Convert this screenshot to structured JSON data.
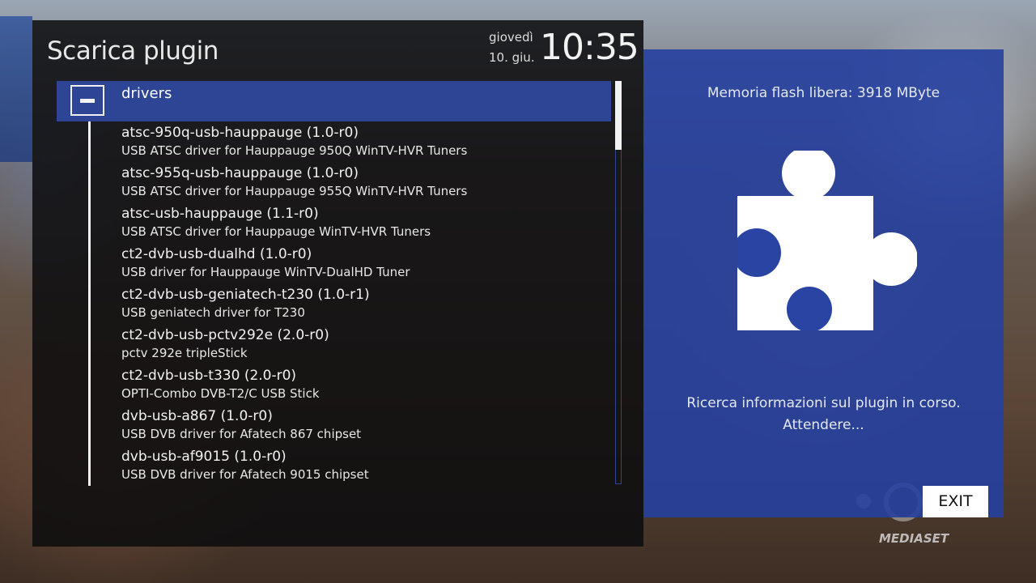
{
  "header": {
    "title": "Scarica plugin",
    "day": "giovedì",
    "date": "10. giu.",
    "time": "10:35"
  },
  "list": {
    "category": "drivers",
    "items": [
      {
        "name": "atsc-950q-usb-hauppauge  (1.0-r0)",
        "description": "USB ATSC driver for Hauppauge 950Q WinTV-HVR Tuners"
      },
      {
        "name": "atsc-955q-usb-hauppauge  (1.0-r0)",
        "description": "USB ATSC driver for Hauppauge 955Q WinTV-HVR Tuners"
      },
      {
        "name": "atsc-usb-hauppauge  (1.1-r0)",
        "description": "USB ATSC driver for Hauppauge WinTV-HVR Tuners"
      },
      {
        "name": "ct2-dvb-usb-dualhd  (1.0-r0)",
        "description": "USB driver for Hauppauge WinTV-DualHD Tuner"
      },
      {
        "name": "ct2-dvb-usb-geniatech-t230  (1.0-r1)",
        "description": "USB geniatech driver for T230"
      },
      {
        "name": "ct2-dvb-usb-pctv292e  (2.0-r0)",
        "description": "pctv 292e tripleStick"
      },
      {
        "name": "ct2-dvb-usb-t330  (2.0-r0)",
        "description": "OPTI-Combo DVB-T2/C USB Stick"
      },
      {
        "name": "dvb-usb-a867  (1.0-r0)",
        "description": "USB DVB driver for Afatech 867 chipset"
      },
      {
        "name": "dvb-usb-af9015  (1.0-r0)",
        "description": "USB DVB driver for Afatech 9015 chipset"
      }
    ]
  },
  "info": {
    "flash_memory": "Memoria flash libera: 3918 MByte",
    "icon": "puzzle-piece-icon",
    "status_line1": "Ricerca informazioni sul plugin in corso.",
    "status_line2": "Attendere..."
  },
  "buttons": {
    "exit": "EXIT"
  },
  "logo": {
    "text": "MEDIASET"
  },
  "colors": {
    "accent_blue": "#2e4596",
    "panel_blue": "#2640a0",
    "panel_dark": "#0c0c0e"
  }
}
